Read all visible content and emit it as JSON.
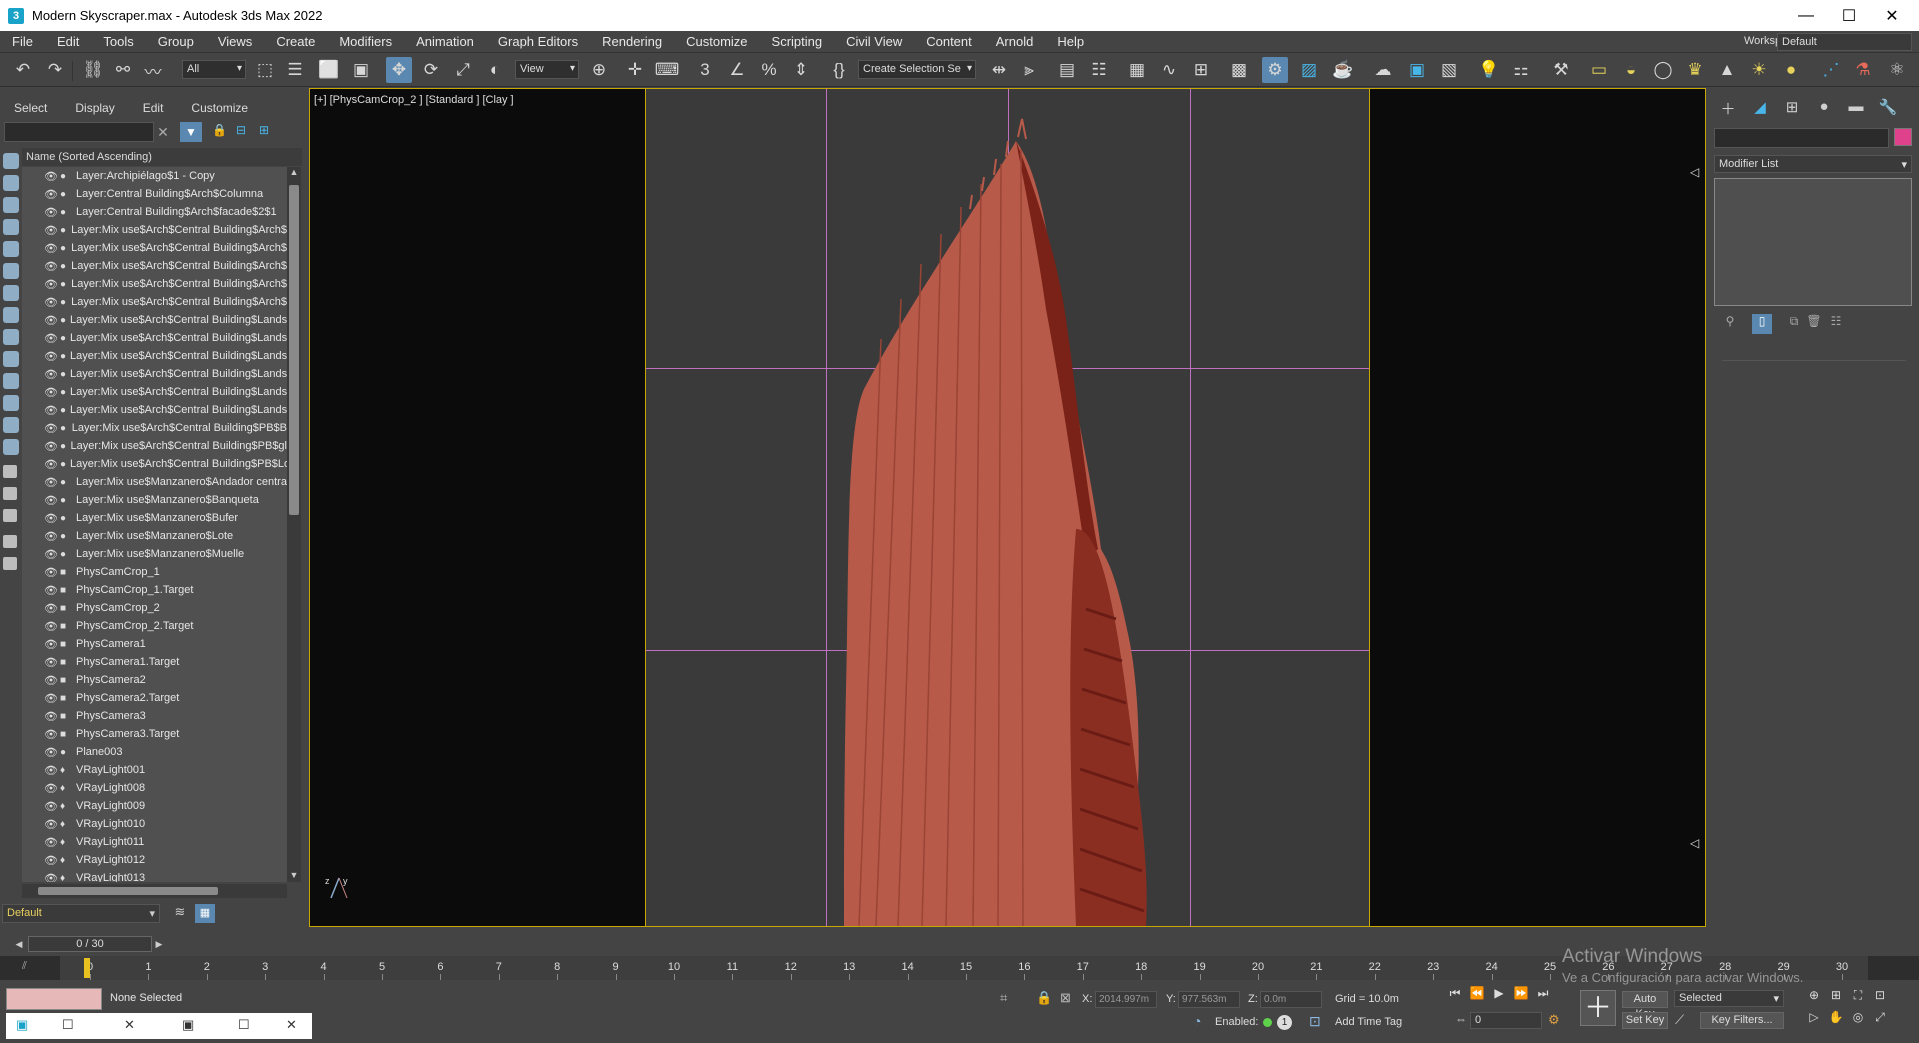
{
  "window": {
    "title": "Modern Skyscraper.max - Autodesk 3ds Max 2022",
    "controls": [
      "—",
      "☐",
      "✕"
    ]
  },
  "menu": {
    "items": [
      "File",
      "Edit",
      "Tools",
      "Group",
      "Views",
      "Create",
      "Modifiers",
      "Animation",
      "Graph Editors",
      "Rendering",
      "Customize",
      "Scripting",
      "Civil View",
      "Content",
      "Arnold",
      "Help"
    ],
    "workspaces_label": "Workspaces:",
    "workspace_value": "Default"
  },
  "toolbar": {
    "filter_value": "All",
    "refcoord_value": "View",
    "named_selection_placeholder": "Create Selection Se"
  },
  "scene_explorer": {
    "tabs": [
      "Select",
      "Display",
      "Edit",
      "Customize"
    ],
    "column_header": "Name (Sorted Ascending)",
    "rows": [
      {
        "type": "layer",
        "name": "Layer:Archipiélago$1 - Copy"
      },
      {
        "type": "layer",
        "name": "Layer:Central Building$Arch$Columna"
      },
      {
        "type": "layer",
        "name": "Layer:Central Building$Arch$facade$2$1"
      },
      {
        "type": "layer",
        "name": "Layer:Mix use$Arch$Central Building$Arch$"
      },
      {
        "type": "layer",
        "name": "Layer:Mix use$Arch$Central Building$Arch$"
      },
      {
        "type": "layer",
        "name": "Layer:Mix use$Arch$Central Building$Arch$"
      },
      {
        "type": "layer",
        "name": "Layer:Mix use$Arch$Central Building$Arch$"
      },
      {
        "type": "layer",
        "name": "Layer:Mix use$Arch$Central Building$Arch$"
      },
      {
        "type": "layer",
        "name": "Layer:Mix use$Arch$Central Building$Lands"
      },
      {
        "type": "layer",
        "name": "Layer:Mix use$Arch$Central Building$Lands"
      },
      {
        "type": "layer",
        "name": "Layer:Mix use$Arch$Central Building$Lands"
      },
      {
        "type": "layer",
        "name": "Layer:Mix use$Arch$Central Building$Lands"
      },
      {
        "type": "layer",
        "name": "Layer:Mix use$Arch$Central Building$Lands"
      },
      {
        "type": "layer",
        "name": "Layer:Mix use$Arch$Central Building$Lands"
      },
      {
        "type": "layer",
        "name": "Layer:Mix use$Arch$Central Building$PB$B"
      },
      {
        "type": "layer",
        "name": "Layer:Mix use$Arch$Central Building$PB$gl"
      },
      {
        "type": "layer",
        "name": "Layer:Mix use$Arch$Central Building$PB$Lo"
      },
      {
        "type": "layer",
        "name": "Layer:Mix use$Manzanero$Andador centra"
      },
      {
        "type": "layer",
        "name": "Layer:Mix use$Manzanero$Banqueta"
      },
      {
        "type": "layer",
        "name": "Layer:Mix use$Manzanero$Bufer"
      },
      {
        "type": "layer",
        "name": "Layer:Mix use$Manzanero$Lote"
      },
      {
        "type": "layer",
        "name": "Layer:Mix use$Manzanero$Muelle"
      },
      {
        "type": "camera",
        "name": "PhysCamCrop_1"
      },
      {
        "type": "camera",
        "name": "PhysCamCrop_1.Target"
      },
      {
        "type": "camera",
        "name": "PhysCamCrop_2"
      },
      {
        "type": "camera",
        "name": "PhysCamCrop_2.Target"
      },
      {
        "type": "camera",
        "name": "PhysCamera1"
      },
      {
        "type": "camera",
        "name": "PhysCamera1.Target"
      },
      {
        "type": "camera",
        "name": "PhysCamera2"
      },
      {
        "type": "camera",
        "name": "PhysCamera2.Target"
      },
      {
        "type": "camera",
        "name": "PhysCamera3"
      },
      {
        "type": "camera",
        "name": "PhysCamera3.Target"
      },
      {
        "type": "geometry",
        "name": "Plane003"
      },
      {
        "type": "light",
        "name": "VRayLight001"
      },
      {
        "type": "light",
        "name": "VRayLight008"
      },
      {
        "type": "light",
        "name": "VRayLight009"
      },
      {
        "type": "light",
        "name": "VRayLight010"
      },
      {
        "type": "light",
        "name": "VRayLight011"
      },
      {
        "type": "light",
        "name": "VRayLight012"
      },
      {
        "type": "light",
        "name": "VRayLight013"
      }
    ],
    "layer_value": "Default"
  },
  "viewport": {
    "label": "[+] [PhysCamCrop_2 ] [Standard ] [Clay ]",
    "colors": {
      "frame": "#c8a800",
      "grid": "#c070c0",
      "building": "#b85a4a",
      "building_dark": "#7a2218"
    }
  },
  "command_panel": {
    "modifier_list": "Modifier List",
    "object_color": "#e0418c"
  },
  "timeline": {
    "slider_label": "0 / 30",
    "ticks": [
      "0",
      "1",
      "2",
      "3",
      "4",
      "5",
      "6",
      "7",
      "8",
      "9",
      "10",
      "11",
      "12",
      "13",
      "14",
      "15",
      "16",
      "17",
      "18",
      "19",
      "20",
      "21",
      "22",
      "23",
      "24",
      "25",
      "26",
      "27",
      "28",
      "29",
      "30"
    ]
  },
  "status": {
    "selection": "None Selected",
    "x_label": "X:",
    "x_value": "2014.997m",
    "y_label": "Y:",
    "y_value": "977.563m",
    "z_label": "Z:",
    "z_value": "0.0m",
    "grid": "Grid = 10.0m",
    "enabled_label": "Enabled:",
    "enabled_count": "1",
    "add_time_tag": "Add Time Tag",
    "frame_value": "0",
    "auto_key": "Auto Key",
    "set_key": "Set Key",
    "selected_value": "Selected",
    "key_filters": "Key Filters...",
    "activate_title": "Activar Windows",
    "activate_sub": "Ve a Configuración para activar Windows."
  }
}
